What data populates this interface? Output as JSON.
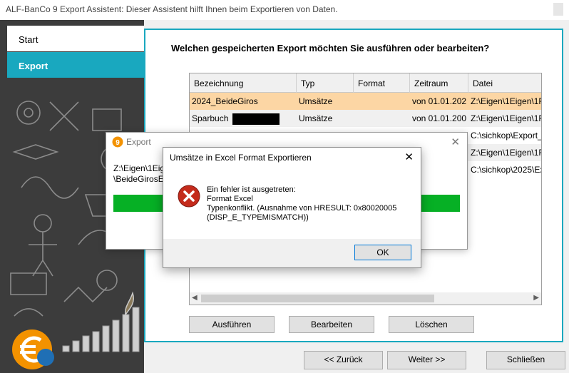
{
  "window": {
    "title": "ALF-BanCo 9 Export Assistent: Dieser Assistent hilft Ihnen beim Exportieren von Daten."
  },
  "sidebar": {
    "items": [
      {
        "label": "Start"
      },
      {
        "label": "Export"
      }
    ],
    "logo_text": "9"
  },
  "main": {
    "question": "Welchen gespeicherten Export möchten Sie ausführen oder bearbeiten?",
    "grid": {
      "columns": [
        "Bezeichnung",
        "Typ",
        "Format",
        "Zeitraum",
        "Datei"
      ],
      "rows": [
        {
          "bez": "2024_BeideGiros",
          "typ": "Umsätze",
          "format": "",
          "zeit": "von 01.01.202",
          "datei": "Z:\\Eigen\\1Eigen\\1F"
        },
        {
          "bez": "Sparbuch ",
          "typ": "Umsätze",
          "format": "",
          "zeit": "von 01.01.200",
          "datei": "Z:\\Eigen\\1Eigen\\1F"
        },
        {
          "bez": "",
          "typ": "",
          "format": "",
          "zeit": "",
          "datei": "C:\\sichkop\\Export_"
        },
        {
          "bez": "",
          "typ": "",
          "format": "",
          "zeit": "",
          "datei": "Z:\\Eigen\\1Eigen\\1F"
        },
        {
          "bez": "",
          "typ": "",
          "format": "",
          "zeit": "",
          "datei": "C:\\sichkop\\2025\\Ex"
        }
      ]
    },
    "buttons": {
      "execute": "Ausführen",
      "edit": "Bearbeiten",
      "delete": "Löschen"
    }
  },
  "footer": {
    "back": "<< Zurück",
    "next": "Weiter >>",
    "close": "Schließen"
  },
  "export_dialog": {
    "title": "Export",
    "path": "Z:\\Eigen\\1Eig\n\\BeideGirosE",
    "progress": 1.0
  },
  "error_dialog": {
    "title": "Umsätze in Excel Format Exportieren",
    "message": [
      "Ein fehler ist ausgetreten:",
      "Format Excel",
      "Typenkonflikt. (Ausnahme von HRESULT: 0x80020005",
      "(DISP_E_TYPEMISMATCH))"
    ],
    "ok": "OK"
  },
  "colors": {
    "accent": "#19a8bf",
    "selected_row": "#fcd6a4",
    "progress": "#06b025",
    "error_icon": "#c42b1c",
    "logo": "#f39200"
  }
}
